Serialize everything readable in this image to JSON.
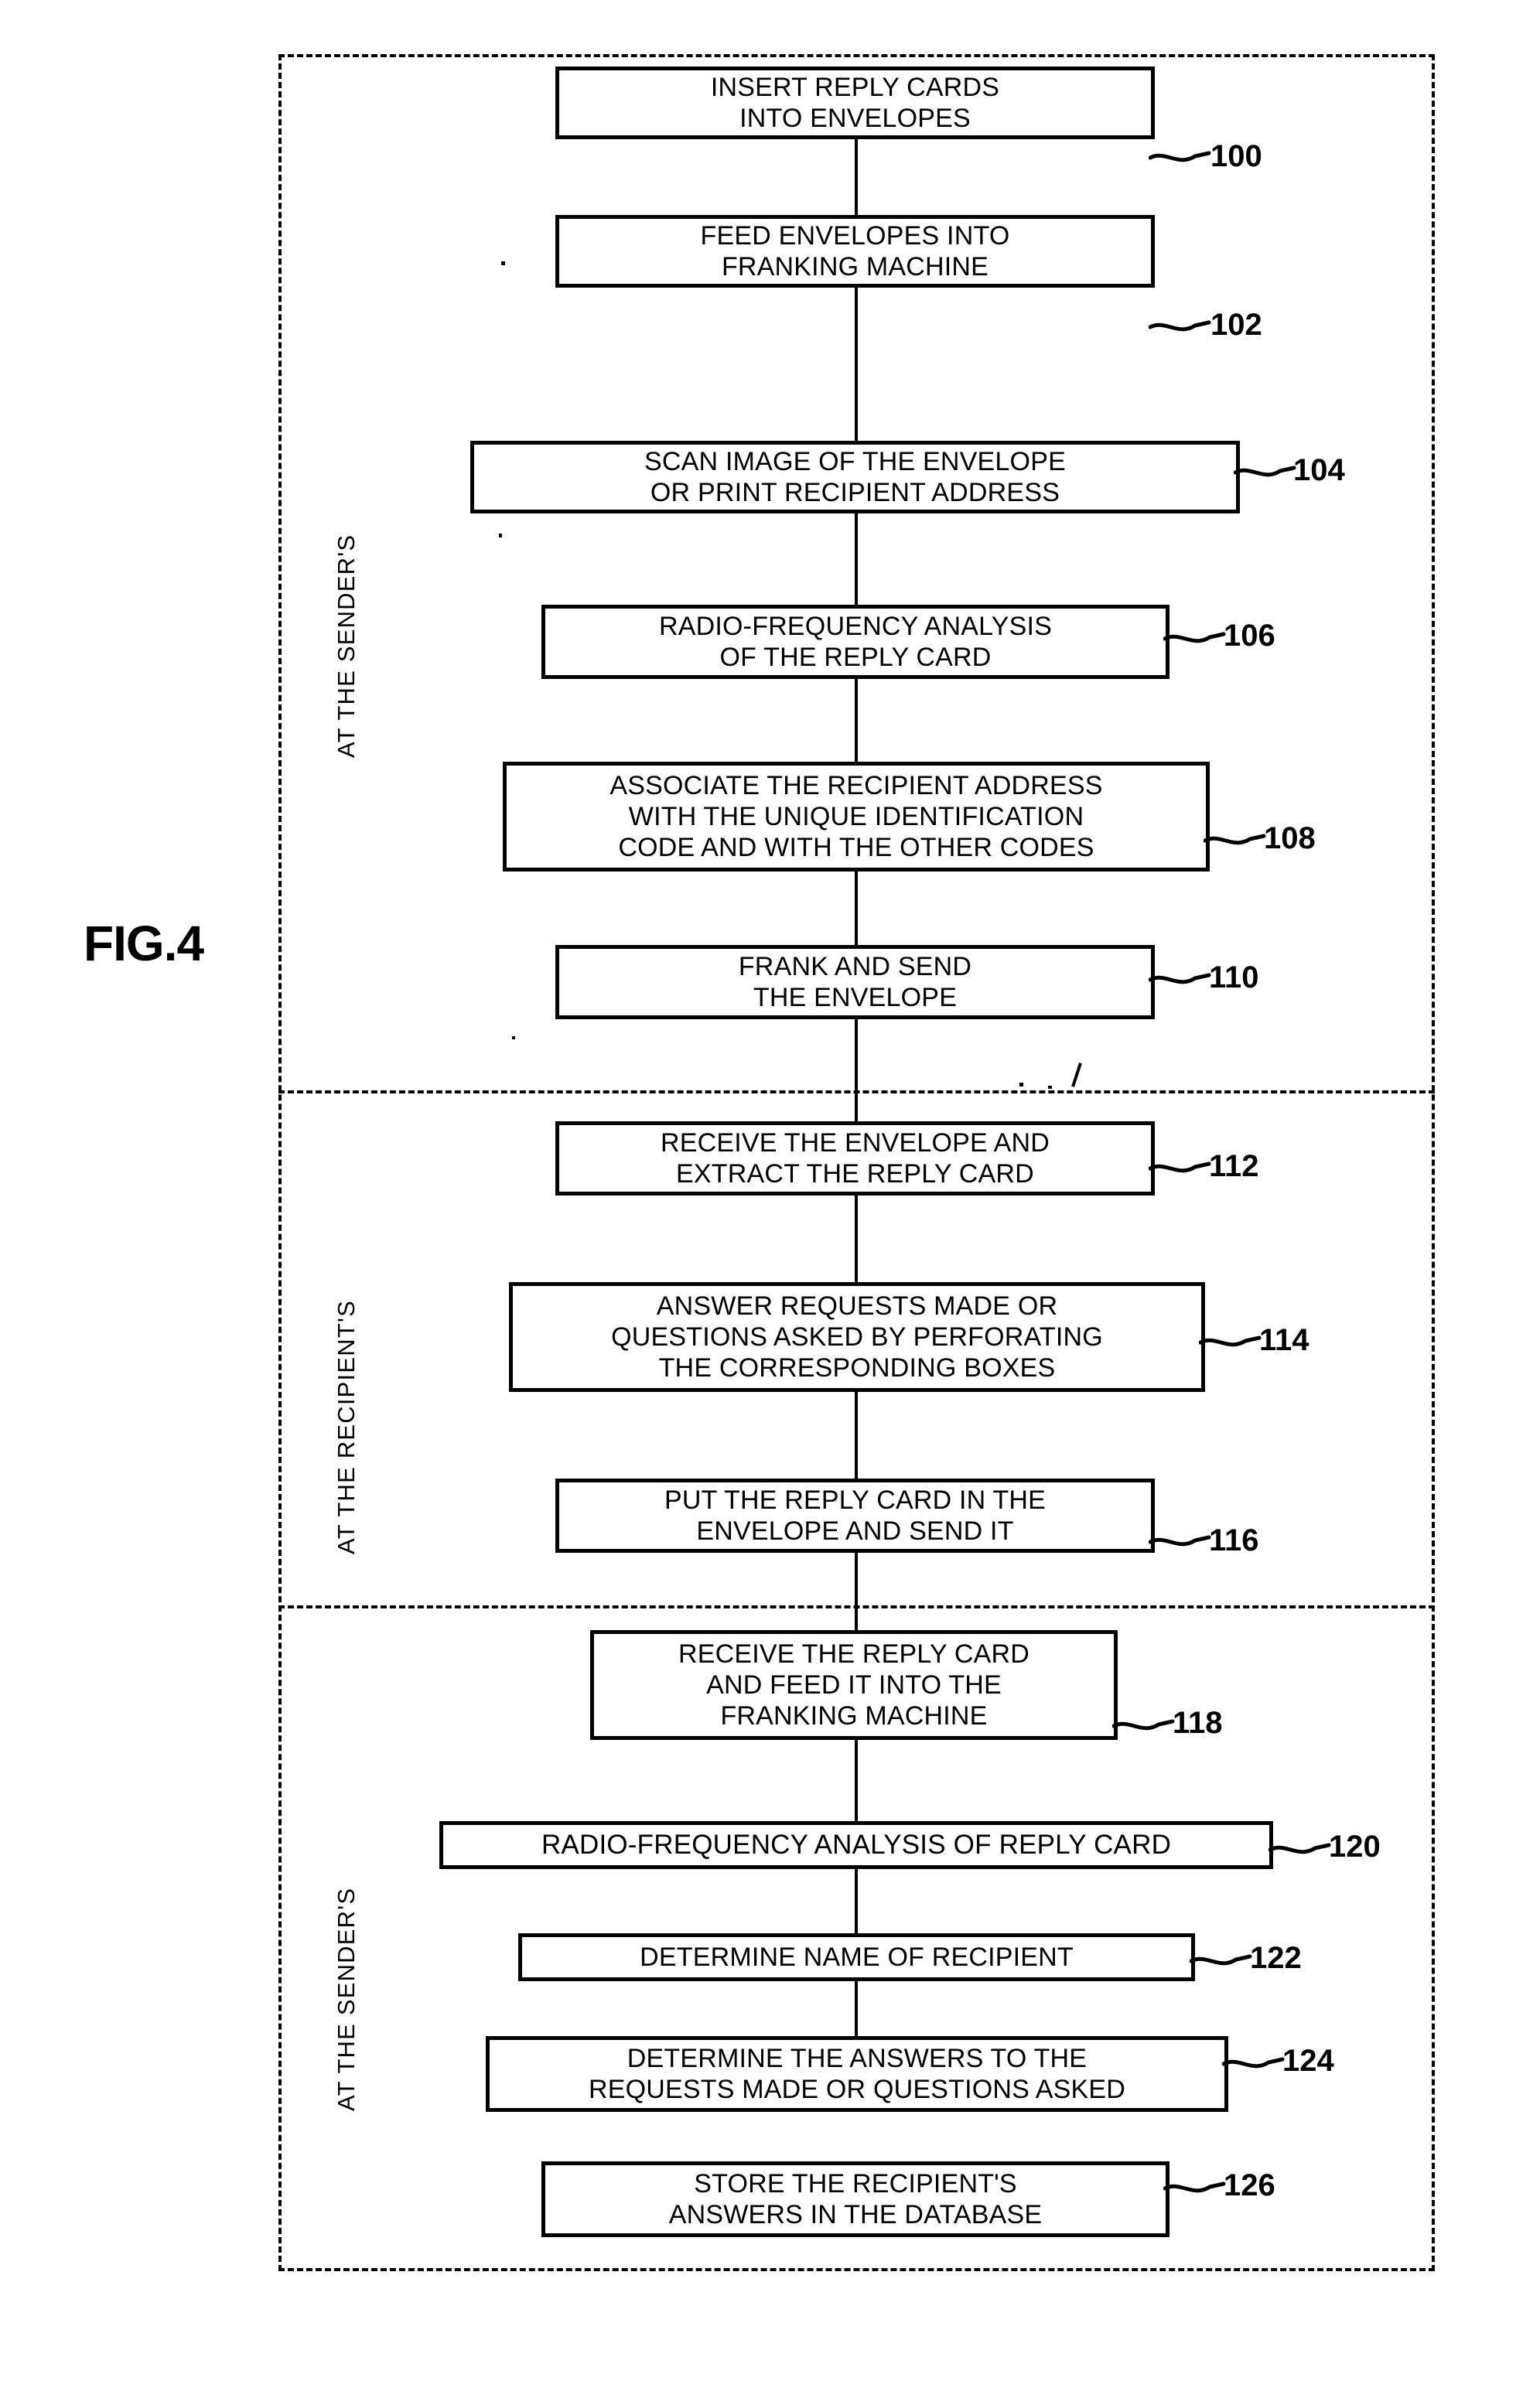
{
  "figure": {
    "label": "FIG.4"
  },
  "lanes": [
    {
      "id": "lane-sender-top",
      "label": "AT THE SENDER'S"
    },
    {
      "id": "lane-recipient",
      "label": "AT THE RECIPIENT'S"
    },
    {
      "id": "lane-sender-bottom",
      "label": "AT THE SENDER'S"
    }
  ],
  "flowchart": {
    "type": "flowchart",
    "orientation": "top-to-bottom",
    "steps": [
      {
        "ref": "100",
        "lane": 0,
        "lines": [
          "INSERT REPLY CARDS",
          "INTO ENVELOPES"
        ]
      },
      {
        "ref": "102",
        "lane": 0,
        "lines": [
          "FEED ENVELOPES INTO",
          "FRANKING MACHINE"
        ]
      },
      {
        "ref": "104",
        "lane": 0,
        "lines": [
          "SCAN IMAGE OF THE ENVELOPE",
          "OR PRINT RECIPIENT ADDRESS"
        ]
      },
      {
        "ref": "106",
        "lane": 0,
        "lines": [
          "RADIO-FREQUENCY ANALYSIS",
          "OF THE REPLY CARD"
        ]
      },
      {
        "ref": "108",
        "lane": 0,
        "lines": [
          "ASSOCIATE THE RECIPIENT ADDRESS",
          "WITH THE UNIQUE IDENTIFICATION",
          "CODE AND WITH THE OTHER CODES"
        ]
      },
      {
        "ref": "110",
        "lane": 0,
        "lines": [
          "FRANK AND SEND",
          "THE ENVELOPE"
        ]
      },
      {
        "ref": "112",
        "lane": 1,
        "lines": [
          "RECEIVE THE ENVELOPE AND",
          "EXTRACT THE REPLY CARD"
        ]
      },
      {
        "ref": "114",
        "lane": 1,
        "lines": [
          "ANSWER REQUESTS MADE OR",
          "QUESTIONS ASKED BY PERFORATING",
          "THE CORRESPONDING BOXES"
        ]
      },
      {
        "ref": "116",
        "lane": 1,
        "lines": [
          "PUT THE REPLY CARD IN THE",
          "ENVELOPE AND SEND IT"
        ]
      },
      {
        "ref": "118",
        "lane": 2,
        "lines": [
          "RECEIVE THE REPLY CARD",
          "AND FEED IT INTO THE",
          "FRANKING MACHINE"
        ]
      },
      {
        "ref": "120",
        "lane": 2,
        "lines": [
          "RADIO-FREQUENCY ANALYSIS OF REPLY CARD"
        ]
      },
      {
        "ref": "122",
        "lane": 2,
        "lines": [
          "DETERMINE NAME OF RECIPIENT"
        ]
      },
      {
        "ref": "124",
        "lane": 2,
        "lines": [
          "DETERMINE THE ANSWERS TO THE",
          "REQUESTS MADE OR QUESTIONS ASKED"
        ]
      },
      {
        "ref": "126",
        "lane": 2,
        "lines": [
          "STORE THE RECIPIENT'S",
          "ANSWERS IN THE DATABASE"
        ]
      }
    ]
  },
  "colors": {
    "ink": "#000000",
    "paper": "#ffffff"
  }
}
